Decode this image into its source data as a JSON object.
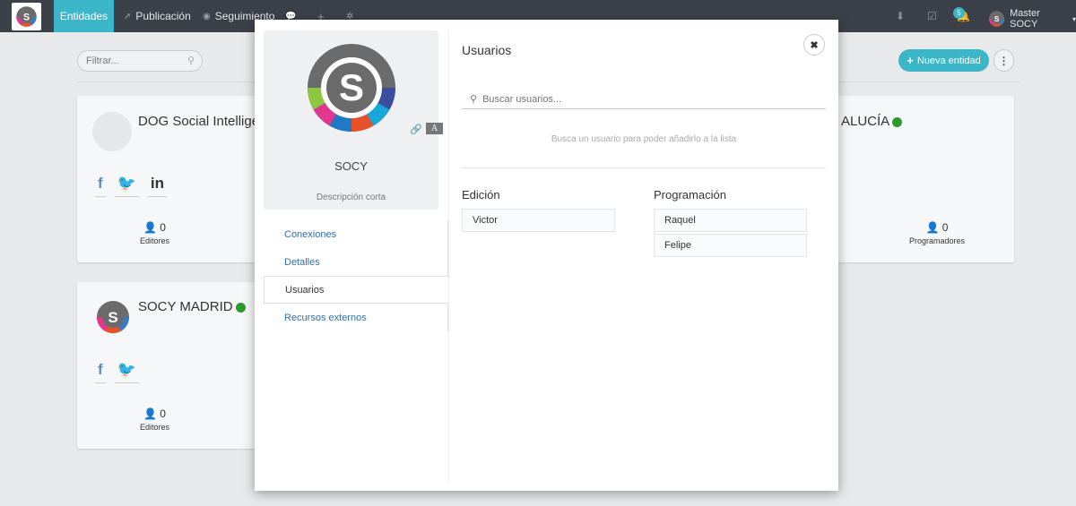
{
  "navbar": {
    "tabs": [
      {
        "label": "Entidades"
      },
      {
        "label": "Publicación"
      },
      {
        "label": "Seguimiento"
      }
    ],
    "notification_count": "5",
    "user_name": "Master SOCY"
  },
  "toolbar": {
    "filter_placeholder": "Filtrar...",
    "new_entity_label": "Nueva entidad"
  },
  "cards": [
    {
      "title": "DOG Social Intellige",
      "stat_value": "0",
      "stat_label": "Editores"
    },
    {
      "title": "SOCY MADRID",
      "stat_value": "0",
      "stat_label": "Editores"
    },
    {
      "title": "ALUCÍA",
      "stat_value": "0",
      "stat_label": "Programadores"
    }
  ],
  "modal": {
    "entity_name": "SOCY",
    "entity_description": "Descripción corta",
    "nav": [
      {
        "label": "Conexiones"
      },
      {
        "label": "Detalles"
      },
      {
        "label": "Usuarios"
      },
      {
        "label": "Recursos externos"
      }
    ],
    "users_title": "Usuarios",
    "search_placeholder": "Buscar usuarios...",
    "hint": "Busca un usuario para poder añadirlo a la lista",
    "edicion": {
      "title": "Edición",
      "users": [
        "Victor"
      ]
    },
    "programacion": {
      "title": "Programación",
      "users": [
        "Raquel",
        "Felipe"
      ]
    }
  },
  "colors": {
    "accent": "#3ab6c8",
    "navbar": "#3c4149",
    "online": "#2c9a2c",
    "link": "#2e6fae"
  }
}
